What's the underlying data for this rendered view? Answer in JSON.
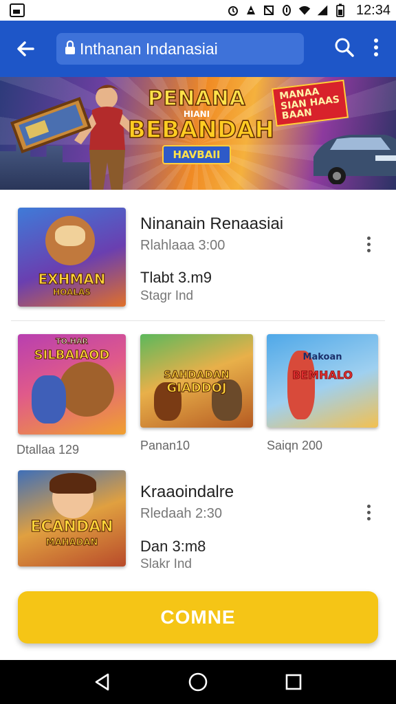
{
  "status_bar": {
    "time": "12:34",
    "icons": [
      "image-icon",
      "alarm-icon",
      "data-saver-icon",
      "no-notifications-icon",
      "info-icon",
      "wifi-icon",
      "signal-icon",
      "battery-icon"
    ]
  },
  "app_bar": {
    "address_text": "Inthanan Indanasiai",
    "icons": [
      "back-arrow-icon",
      "lock-icon",
      "search-icon",
      "more-vert-icon"
    ],
    "color": "#1e56c8"
  },
  "banner": {
    "title_line1": "PENANA",
    "title_line2": "HIANI",
    "title_line3": "BEBANDAH",
    "title_line4": "HAVBAII",
    "tag_line1": "MANAA",
    "tag_line2": "SIAN HAAS",
    "tag_line3": "BAAN",
    "carousel_dots": 3,
    "active_dot": 1
  },
  "featured_1": {
    "title": "Ninanain Renaasiai",
    "subtitle": "Rlahlaaa 3:00",
    "size": "Tlabt 3.m9",
    "tag": "Stagr Ind",
    "thumb_text_1": "EXHMAN",
    "thumb_text_2": "HOALAS"
  },
  "grid": [
    {
      "caption": "Dtallaa 129",
      "thumb_text_1": "TO.HAR",
      "thumb_text_2": "SILBAIAOD"
    },
    {
      "caption": "Panan10",
      "thumb_text_1": "SAHDADAN",
      "thumb_text_2": "GIADDOJ"
    },
    {
      "caption": "Saiqn 200",
      "thumb_text_1": "Makoan",
      "thumb_text_2": "BEMHALO"
    }
  ],
  "featured_2": {
    "title": "Kraaoindalre",
    "subtitle": "Rledaah 2:30",
    "size": "Dan 3:m8",
    "tag": "Slakr Ind",
    "thumb_text_1": "ECANDAN",
    "thumb_text_2": "MAHADAN"
  },
  "cta": {
    "label": "COMNE",
    "color": "#f5c516"
  },
  "nav_bar": {
    "icons": [
      "back-triangle-icon",
      "home-circle-icon",
      "recents-square-icon"
    ]
  }
}
